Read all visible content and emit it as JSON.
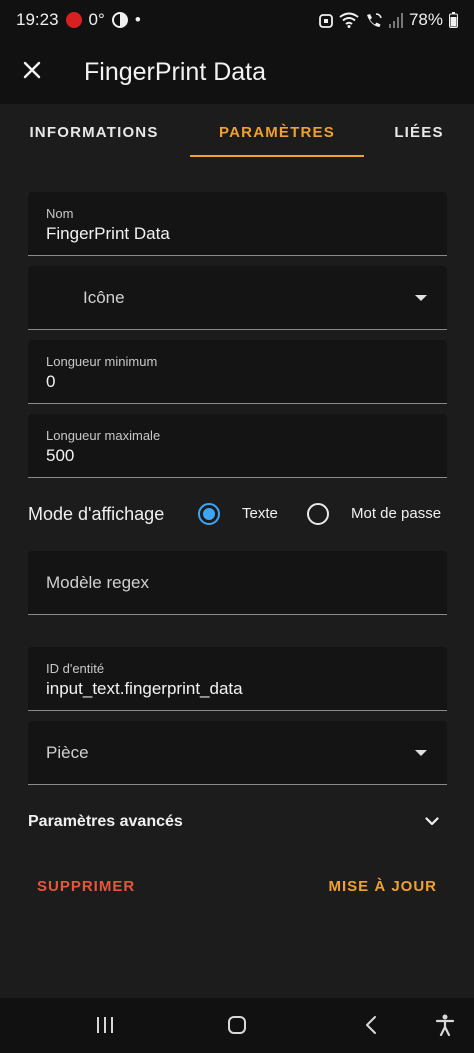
{
  "status_bar": {
    "time": "19:23",
    "temperature": "0°",
    "dot": "•",
    "battery": "78%"
  },
  "app_bar": {
    "title": "FingerPrint Data"
  },
  "tabs": [
    {
      "label": "INFORMATIONS",
      "active": false
    },
    {
      "label": "PARAMÈTRES",
      "active": true
    },
    {
      "label": "LIÉES",
      "active": false
    }
  ],
  "fields": {
    "name": {
      "label": "Nom",
      "value": "FingerPrint Data"
    },
    "icon": {
      "placeholder": "Icône"
    },
    "min_length": {
      "label": "Longueur minimum",
      "value": "0"
    },
    "max_length": {
      "label": "Longueur maximale",
      "value": "500"
    },
    "regex": {
      "placeholder": "Modèle regex"
    },
    "entity_id": {
      "label": "ID d'entité",
      "value": "input_text.fingerprint_data"
    },
    "room": {
      "placeholder": "Pièce"
    }
  },
  "display_mode": {
    "label": "Mode d'affichage",
    "options": [
      {
        "label": "Texte",
        "selected": true
      },
      {
        "label": "Mot de passe",
        "selected": false
      }
    ]
  },
  "advanced": {
    "label": "Paramètres avancés"
  },
  "actions": {
    "delete_label": "SUPPRIMER",
    "update_label": "MISE À JOUR"
  },
  "colors": {
    "accent": "#f0a030",
    "delete": "#e8553a",
    "radio": "#3da5f5"
  }
}
